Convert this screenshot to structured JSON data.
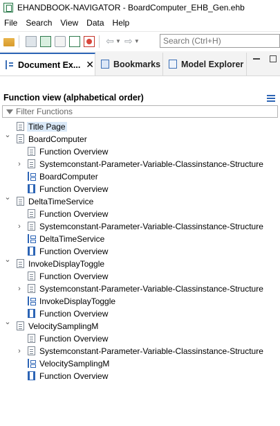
{
  "window": {
    "title": "EHANDBOOK-NAVIGATOR - BoardComputer_EHB_Gen.ehb"
  },
  "menu": [
    {
      "label": "File"
    },
    {
      "label": "Search"
    },
    {
      "label": "View"
    },
    {
      "label": "Data"
    },
    {
      "label": "Help"
    }
  ],
  "toolbar": {
    "search_placeholder": "Search (Ctrl+H)"
  },
  "tabs": [
    {
      "label": "Document Ex...",
      "icon": "document-explorer-icon"
    },
    {
      "label": "Bookmarks",
      "icon": "bookmarks-icon"
    },
    {
      "label": "Model Explorer",
      "icon": "model-explorer-icon"
    }
  ],
  "panel": {
    "title": "Function view (alphabetical order)",
    "filter_placeholder": "Filter Functions"
  },
  "tree": [
    {
      "label": "Title Page",
      "level": 0,
      "icon": "page-icon",
      "selected": true
    },
    {
      "label": "BoardComputer",
      "level": 0,
      "icon": "page-icon",
      "expander": "expanded"
    },
    {
      "label": "Function Overview",
      "level": 1,
      "icon": "page-icon"
    },
    {
      "label": "Systemconstant-Parameter-Variable-Classinstance-Structure",
      "level": 1,
      "icon": "page-icon",
      "expander": "collapsed"
    },
    {
      "label": "BoardComputer",
      "level": 1,
      "icon": "structure-icon"
    },
    {
      "label": "Function Overview",
      "level": 1,
      "icon": "component-icon"
    },
    {
      "label": "DeltaTimeService",
      "level": 0,
      "icon": "page-icon",
      "expander": "expanded"
    },
    {
      "label": "Function Overview",
      "level": 1,
      "icon": "page-icon"
    },
    {
      "label": "Systemconstant-Parameter-Variable-Classinstance-Structure",
      "level": 1,
      "icon": "page-icon",
      "expander": "collapsed"
    },
    {
      "label": "DeltaTimeService",
      "level": 1,
      "icon": "structure-icon"
    },
    {
      "label": "Function Overview",
      "level": 1,
      "icon": "component-icon"
    },
    {
      "label": "InvokeDisplayToggle",
      "level": 0,
      "icon": "page-icon",
      "expander": "expanded"
    },
    {
      "label": "Function Overview",
      "level": 1,
      "icon": "page-icon"
    },
    {
      "label": "Systemconstant-Parameter-Variable-Classinstance-Structure",
      "level": 1,
      "icon": "page-icon",
      "expander": "collapsed"
    },
    {
      "label": "InvokeDisplayToggle",
      "level": 1,
      "icon": "structure-icon"
    },
    {
      "label": "Function Overview",
      "level": 1,
      "icon": "component-icon"
    },
    {
      "label": "VelocitySamplingM",
      "level": 0,
      "icon": "page-icon",
      "expander": "expanded"
    },
    {
      "label": "Function Overview",
      "level": 1,
      "icon": "page-icon"
    },
    {
      "label": "Systemconstant-Parameter-Variable-Classinstance-Structure",
      "level": 1,
      "icon": "page-icon",
      "expander": "collapsed"
    },
    {
      "label": "VelocitySamplingM",
      "level": 1,
      "icon": "structure-icon"
    },
    {
      "label": "Function Overview",
      "level": 1,
      "icon": "component-icon"
    }
  ]
}
